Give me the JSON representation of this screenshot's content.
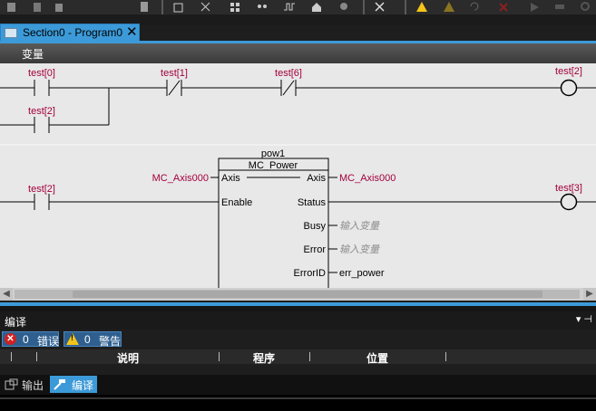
{
  "toolbar": {
    "icons": [
      "copy-icon",
      "settings-icon",
      "grid-icon",
      "network-icon",
      "waveform-icon",
      "home-icon",
      "gear-icon",
      "cursor-icon",
      "warning-icon",
      "warning-disabled-icon",
      "undo-icon",
      "redo-icon",
      "close-icon",
      "play-icon",
      "step-icon",
      "refresh-icon"
    ]
  },
  "tab": {
    "label": "Section0 - Program0",
    "close": "✕"
  },
  "variables_bar": {
    "label": "变量"
  },
  "ladder": {
    "rung1": {
      "contact1": "test[0]",
      "contact2": "test[1]",
      "contact3": "test[6]",
      "contact4": "test[2]",
      "coil": "test[2]"
    },
    "rung2": {
      "contact": "test[2]",
      "coil": "test[3]",
      "fb": {
        "instance": "pow1",
        "type": "MC_Power",
        "inputs": {
          "axis_var": "MC_Axis000",
          "axis_pin": "Axis",
          "enable_pin": "Enable"
        },
        "outputs": {
          "axis_pin": "Axis",
          "axis_var": "MC_Axis000",
          "status_pin": "Status",
          "busy_pin": "Busy",
          "busy_var": "输入变量",
          "error_pin": "Error",
          "error_var": "输入变量",
          "errorid_pin": "ErrorID",
          "errorid_var": "err_power"
        }
      }
    }
  },
  "build_panel": {
    "title": "编译",
    "controls": "▾ ⊣",
    "errors": {
      "count": "0",
      "label": "错误"
    },
    "warnings": {
      "count": "0",
      "label": "警告"
    },
    "columns": [
      "说明",
      "程序",
      "位置"
    ]
  },
  "bottom_tabs": [
    {
      "label": "输出",
      "active": false
    },
    {
      "label": "编译",
      "active": true
    }
  ],
  "colors": {
    "accent": "#3c9ad8",
    "variable_red": "#a3003c",
    "placeholder": "#8c8c8c"
  }
}
